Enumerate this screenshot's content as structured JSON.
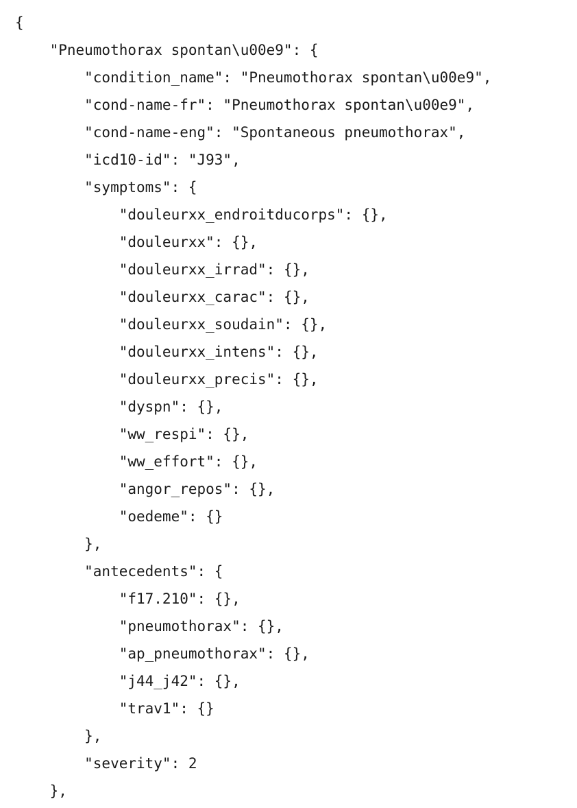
{
  "document": {
    "lines": [
      "{",
      "    \"Pneumothorax spontan\\u00e9\": {",
      "        \"condition_name\": \"Pneumothorax spontan\\u00e9\",",
      "        \"cond-name-fr\": \"Pneumothorax spontan\\u00e9\",",
      "        \"cond-name-eng\": \"Spontaneous pneumothorax\",",
      "        \"icd10-id\": \"J93\",",
      "        \"symptoms\": {",
      "            \"douleurxx_endroitducorps\": {},",
      "            \"douleurxx\": {},",
      "            \"douleurxx_irrad\": {},",
      "            \"douleurxx_carac\": {},",
      "            \"douleurxx_soudain\": {},",
      "            \"douleurxx_intens\": {},",
      "            \"douleurxx_precis\": {},",
      "            \"dyspn\": {},",
      "            \"ww_respi\": {},",
      "            \"ww_effort\": {},",
      "            \"angor_repos\": {},",
      "            \"oedeme\": {}",
      "        },",
      "        \"antecedents\": {",
      "            \"f17.210\": {},",
      "            \"pneumothorax\": {},",
      "            \"ap_pneumothorax\": {},",
      "            \"j44_j42\": {},",
      "            \"trav1\": {}",
      "        },",
      "        \"severity\": 2",
      "    },"
    ]
  }
}
